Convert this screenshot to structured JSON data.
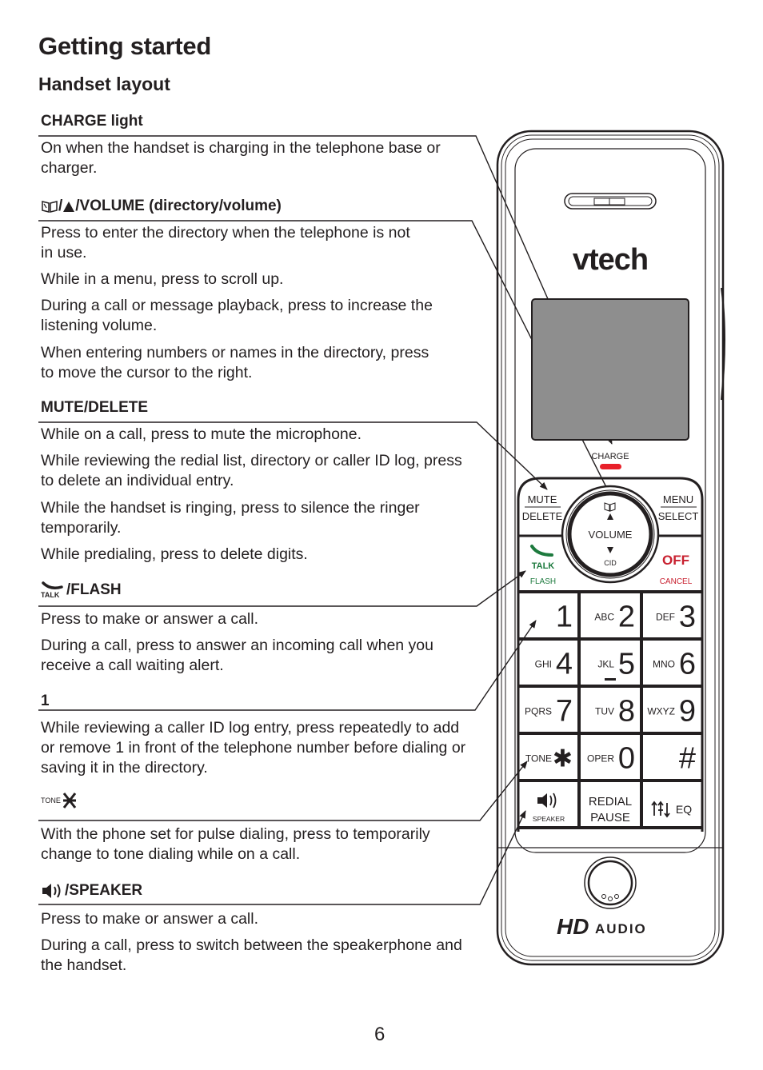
{
  "page": {
    "heading": "Getting started",
    "subheading": "Handset layout",
    "page_number": "6"
  },
  "sections": [
    {
      "icon": "",
      "title": "CHARGE light",
      "paragraphs": [
        "On when the handset is charging in the telephone base or charger."
      ]
    },
    {
      "icon": "directory-book-icon / up-triangle-icon",
      "title": "/VOLUME (directory/volume)",
      "paragraphs": [
        "Press to enter the directory when the telephone is not in use.",
        "While in a menu, press to scroll up.",
        "During a call or message playback, press to increase the listening volume.",
        "When entering numbers or names in the directory, press to move the cursor to the right."
      ]
    },
    {
      "icon": "",
      "title": "MUTE/DELETE",
      "paragraphs": [
        "While on a call, press to mute the microphone.",
        "While reviewing the redial list, directory or caller ID log, press to delete an individual entry.",
        "While the handset is ringing, press to silence the ringer temporarily.",
        "While predialing, press to delete digits."
      ]
    },
    {
      "icon": "talk-phone-icon",
      "icon_label": "TALK",
      "title": "/FLASH",
      "paragraphs": [
        "Press to make or answer a call.",
        "During a call, press to answer an incoming call when you receive a call waiting alert."
      ]
    },
    {
      "icon": "",
      "title": "1",
      "paragraphs": [
        "While reviewing a caller ID log entry, press repeatedly to add or remove 1 in front of the telephone number before dialing or saving it in the directory."
      ]
    },
    {
      "icon": "tone-star-icon",
      "icon_label": "TONE",
      "title": "",
      "paragraphs": [
        "With the phone set for pulse dialing, press to temporarily change to tone dialing while on a call."
      ]
    },
    {
      "icon": "speaker-icon",
      "title": "/SPEAKER",
      "paragraphs": [
        "Press to make or answer a call.",
        "During a call, press to switch between the speakerphone and the handset."
      ]
    }
  ],
  "handset": {
    "brand": "vtech",
    "charge_label": "CHARGE",
    "mute_label": "MUTE",
    "delete_label": "DELETE",
    "menu_label": "MENU",
    "select_label": "SELECT",
    "volume_label": "VOLUME",
    "cid_label": "CID",
    "talk_label": "TALK",
    "flash_label": "FLASH",
    "off_label": "OFF",
    "cancel_label": "CANCEL",
    "keys": [
      {
        "letters": "",
        "digit": "1"
      },
      {
        "letters": "ABC",
        "digit": "2"
      },
      {
        "letters": "DEF",
        "digit": "3"
      },
      {
        "letters": "GHI",
        "digit": "4"
      },
      {
        "letters": "JKL",
        "digit": "5"
      },
      {
        "letters": "MNO",
        "digit": "6"
      },
      {
        "letters": "PQRS",
        "digit": "7"
      },
      {
        "letters": "TUV",
        "digit": "8"
      },
      {
        "letters": "WXYZ",
        "digit": "9"
      },
      {
        "letters": "TONE",
        "digit": "✱"
      },
      {
        "letters": "OPER",
        "digit": "0"
      },
      {
        "letters": "",
        "digit": "#"
      }
    ],
    "speaker_label": "SPEAKER",
    "redial_label": "REDIAL",
    "pause_label": "PAUSE",
    "eq_label": "EQ",
    "hd_label": "HD",
    "audio_label": "AUDIO",
    "colors": {
      "charge_red": "#e8202a",
      "talk_green": "#1d7a3e",
      "off_red": "#c8202f",
      "screen_gray": "#8e8e8e"
    }
  }
}
